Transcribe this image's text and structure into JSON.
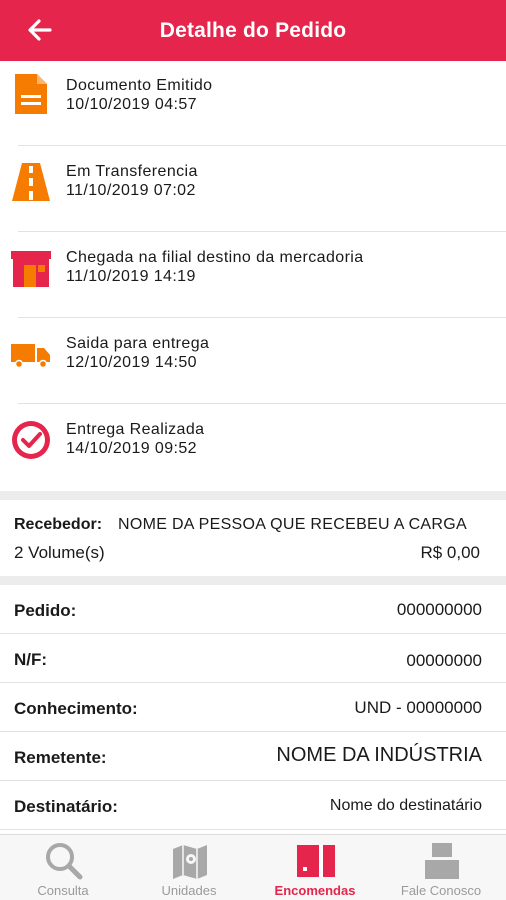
{
  "header": {
    "title": "Detalhe do Pedido"
  },
  "timeline": [
    {
      "title": "Documento Emitido",
      "date": "10/10/2019 04:57",
      "icon": "document-icon"
    },
    {
      "title": "Em Transferencia",
      "date": "11/10/2019 07:02",
      "icon": "road-icon"
    },
    {
      "title": "Chegada na filial destino da mercadoria",
      "date": "11/10/2019 14:19",
      "icon": "warehouse-icon"
    },
    {
      "title": "Saida para entrega",
      "date": "12/10/2019 14:50",
      "icon": "truck-icon"
    },
    {
      "title": "Entrega Realizada",
      "date": "14/10/2019 09:52",
      "icon": "check-circle-icon"
    }
  ],
  "receiver": {
    "label": "Recebedor:",
    "name": "NOME DA PESSOA QUE RECEBEU A CARGA",
    "volumes": "2 Volume(s)",
    "price": "R$ 0,00"
  },
  "details": [
    {
      "label": "Pedido:",
      "value": "000000000"
    },
    {
      "label": "N/F:",
      "value": "00000000"
    },
    {
      "label": "Conhecimento:",
      "value": "UND - 00000000"
    },
    {
      "label": "Remetente:",
      "value": "NOME DA INDÚSTRIA"
    },
    {
      "label": "Destinatário:",
      "value": "Nome do destinatário"
    }
  ],
  "tabs": [
    {
      "label": "Consulta",
      "icon": "search-icon"
    },
    {
      "label": "Unidades",
      "icon": "map-icon"
    },
    {
      "label": "Encomendas",
      "icon": "package-icon",
      "active": true
    },
    {
      "label": "Fale Conosco",
      "icon": "phone-icon"
    }
  ],
  "colors": {
    "brand": "#e5254b",
    "accent_orange": "#f57c00",
    "inactive": "#9a9a9a"
  }
}
